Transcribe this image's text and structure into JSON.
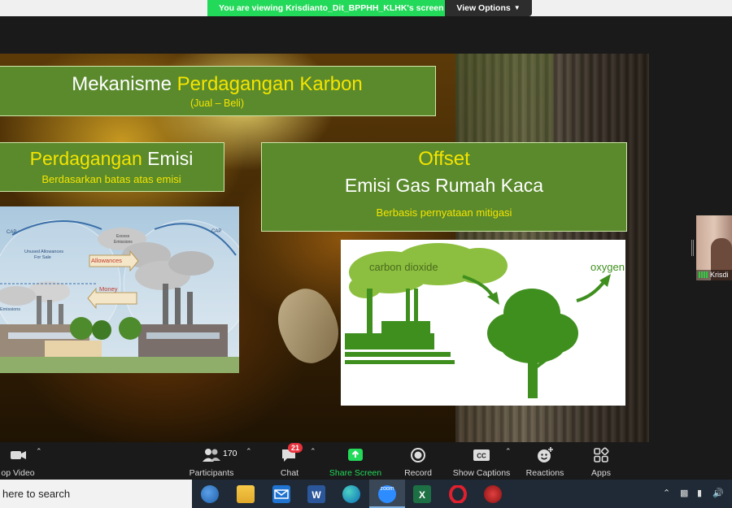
{
  "banner": {
    "viewing_text": "You are viewing Krisdianto_Dit_BPPHH_KLHK's screen",
    "view_options_label": "View Options"
  },
  "slide": {
    "title_white": "Mekanisme ",
    "title_yellow": "Perdagangan Karbon",
    "title_sub": "(Jual – Beli)",
    "left_yellow": "Perdagangan ",
    "left_white": "Emisi",
    "left_sub": "Berdasarkan batas atas emisi",
    "right_h1": "Offset",
    "right_h2": "Emisi Gas Rumah Kaca",
    "right_sub": "Berbasis pernyataan mitigasi",
    "cap_image": {
      "cap_left": "CAP",
      "cap_right": "CAP",
      "unused": "Unused Allowances\nFor Sale",
      "excess": "Excess\nEmissions",
      "allowances": "Allowances",
      "money": "Money",
      "emissions": "Emissions"
    },
    "co2_image": {
      "carbon_dioxide": "carbon dioxide",
      "oxygen": "oxygen"
    }
  },
  "participant": {
    "name": "Krisdi"
  },
  "toolbar": {
    "video_label": "op Video",
    "participants_label": "Participants",
    "participants_count": "170",
    "chat_label": "Chat",
    "chat_badge": "21",
    "share_label": "Share Screen",
    "record_label": "Record",
    "captions_label": "Show Captions",
    "reactions_label": "Reactions",
    "apps_label": "Apps",
    "share_color": "#23d959"
  },
  "taskbar": {
    "search_text": "here to search",
    "zoom_app_label": "zoom"
  }
}
